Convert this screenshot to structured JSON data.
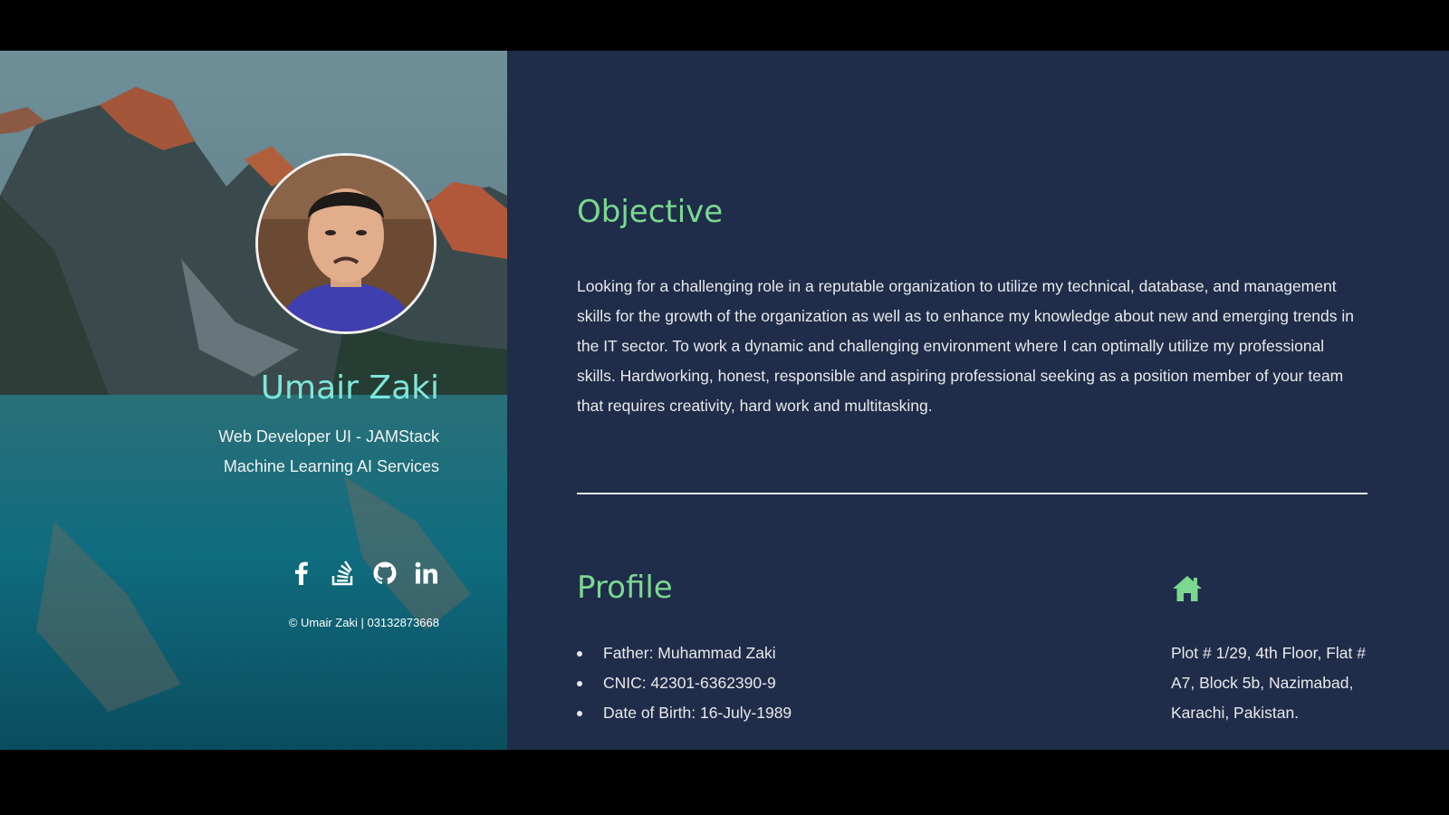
{
  "sidebar": {
    "name": "Umair Zaki",
    "roles": [
      "Web Developer UI - JAMStack",
      "Machine Learning AI Services"
    ],
    "social_icons": [
      "facebook-icon",
      "stackoverflow-icon",
      "github-icon",
      "linkedin-icon"
    ],
    "copyright": "© Umair Zaki | 03132873668"
  },
  "objective": {
    "title": "Objective",
    "text": "Looking for a challenging role in a reputable organization to utilize my technical, database, and management skills for the growth of the organization as well as to enhance my knowledge about new and emerging trends in the IT sector. To work a dynamic and challenging environment where I can optimally utilize my professional skills. Hardworking, honest, responsible and aspiring professional seeking as a position member of your team that requires creativity, hard work and multitasking."
  },
  "profile": {
    "title": "Profile",
    "items": [
      "Father: Muhammad Zaki",
      "CNIC: 42301-6362390-9",
      "Date of Birth: 16-July-1989"
    ],
    "address_icon": "home-icon",
    "address": "Plot # 1/29, 4th Floor, Flat # A7, Block 5b, Nazimabad, Karachi, Pakistan."
  },
  "colors": {
    "accent_green": "#7bd88f",
    "name_teal": "#7de7da",
    "panel_bg": "#1f2d4a"
  }
}
